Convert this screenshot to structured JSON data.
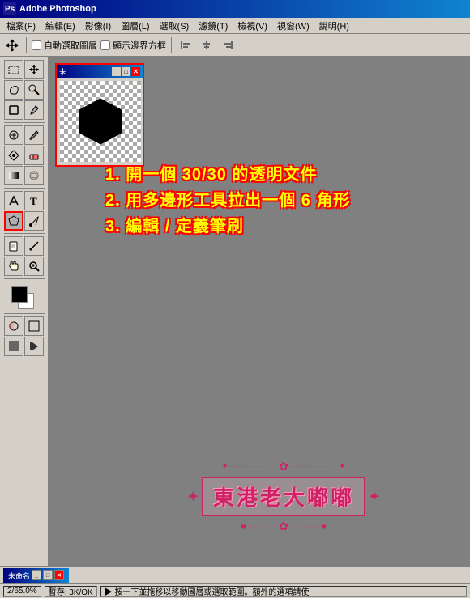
{
  "titleBar": {
    "title": "Adobe Photoshop",
    "icon": "photoshop-icon"
  },
  "menuBar": {
    "items": [
      {
        "label": "檔案(F)",
        "id": "menu-file"
      },
      {
        "label": "編輯(E)",
        "id": "menu-edit"
      },
      {
        "label": "影像(I)",
        "id": "menu-image"
      },
      {
        "label": "圖層(L)",
        "id": "menu-layer"
      },
      {
        "label": "選取(S)",
        "id": "menu-select"
      },
      {
        "label": "濾鏡(T)",
        "id": "menu-filter"
      },
      {
        "label": "檢視(V)",
        "id": "menu-view"
      },
      {
        "label": "視窗(W)",
        "id": "menu-window"
      },
      {
        "label": "說明(H)",
        "id": "menu-help"
      }
    ]
  },
  "toolbar": {
    "autoSelect": "自動選取圖層",
    "showBounds": "顯示邊界方框"
  },
  "docWindow": {
    "title": "未",
    "titleFull": "未命名"
  },
  "instructions": {
    "step1": "1. 開一個 30/30 的透明文件",
    "step2": "2. 用多邊形工具拉出一個 6 角形",
    "step3": "3. 編輯 / 定義筆刷"
  },
  "logo": {
    "text": "東港老大嘟嘟"
  },
  "bottomBar": {
    "title": "未命名",
    "statusLeft": "2/65.0%",
    "statusMid": "暫存: 3K/OK",
    "statusRight": "▶ 按一下並拖移以移動圖層或選取範圍。額外的選項請使"
  },
  "colors": {
    "accent": "#ff0000",
    "titleBlue": "#000080",
    "background": "#808080",
    "panelBg": "#d4d0c8",
    "textYellow": "#ffff00",
    "textOutline": "#ff0000",
    "logoPink": "#cc2266"
  }
}
